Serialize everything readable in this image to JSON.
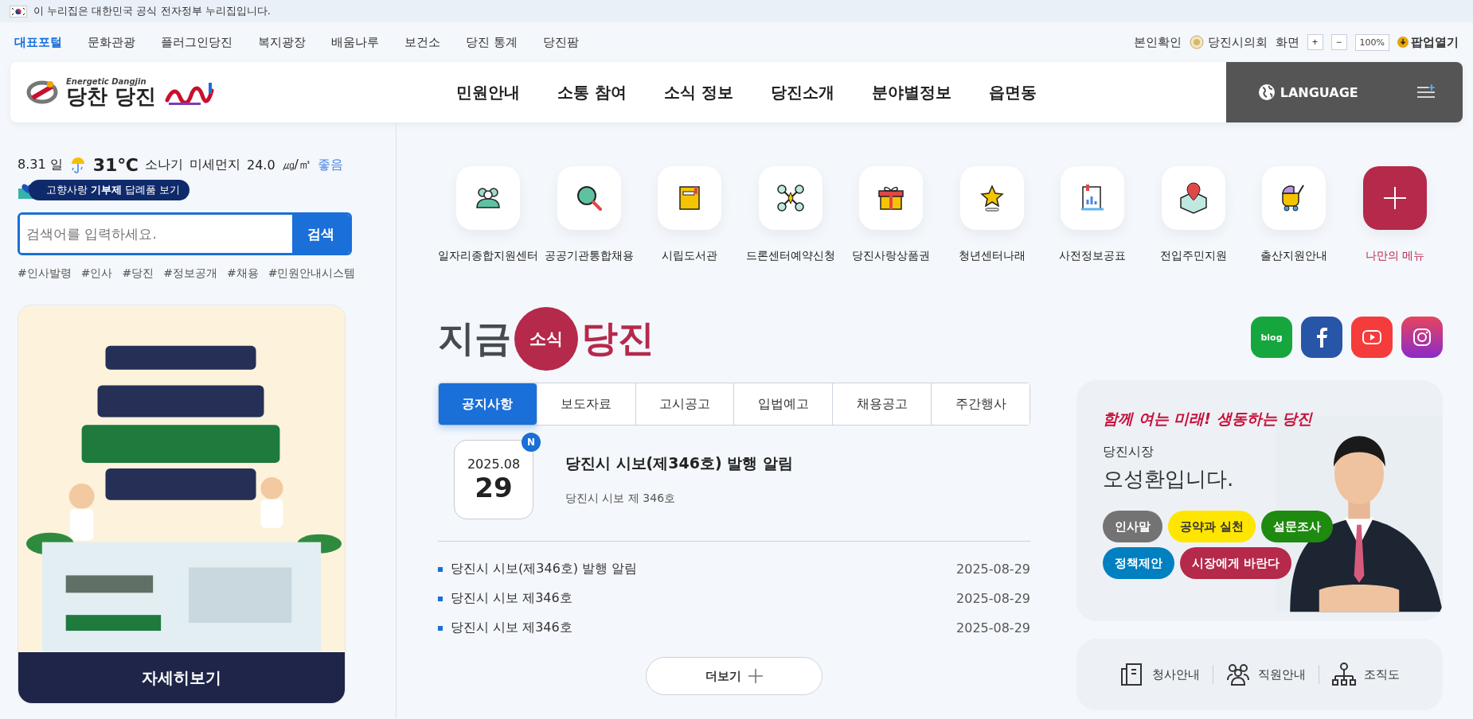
{
  "gov_banner": {
    "text": "이 누리집은 대한민국 공식 전자정부 누리집입니다."
  },
  "utility_nav": {
    "links": [
      {
        "label": "대표포털",
        "selected": true
      },
      {
        "label": "문화관광",
        "selected": false
      },
      {
        "label": "플러그인당진",
        "selected": false
      },
      {
        "label": "복지광장",
        "selected": false
      },
      {
        "label": "배움나루",
        "selected": false
      },
      {
        "label": "보건소",
        "selected": false
      },
      {
        "label": "당진 통계",
        "selected": false
      },
      {
        "label": "당진팜",
        "selected": false
      }
    ],
    "identity": "본인확인",
    "council": "당진시의회",
    "zoom": {
      "label": "화면",
      "plus": "+",
      "minus": "−",
      "value": "100%"
    },
    "popup": "팝업열기"
  },
  "header": {
    "logo": {
      "tagline": "Energetic Dangjin",
      "name": "당찬 당진"
    },
    "menu": [
      "민원안내",
      "소통 참여",
      "소식 정보",
      "당진소개",
      "분야별정보",
      "읍면동"
    ],
    "language": "LANGUAGE"
  },
  "weather": {
    "date": "8.31 일",
    "temperature": "31℃",
    "condition": "소나기",
    "dust_label": "미세먼지",
    "dust_value": "24.0",
    "dust_unit": "㎍/㎥",
    "dust_grade": "좋음"
  },
  "donation_badge": "고향사랑 **기부제** 답례품 보기",
  "search": {
    "placeholder": "검색어를 입력하세요.",
    "button": "검색"
  },
  "tags": [
    "#인사발령",
    "#인사",
    "#당진",
    "#정보공개",
    "#채용",
    "#민원안내시스템"
  ],
  "banner": {
    "kind": "picture",
    "button": "자세히보기"
  },
  "quick_menu": [
    {
      "label": "일자리종합지원센터",
      "kind": "link"
    },
    {
      "label": "공공기관통합채용",
      "kind": "link"
    },
    {
      "label": "시립도서관",
      "kind": "link"
    },
    {
      "label": "드론센터예약신청",
      "kind": "link"
    },
    {
      "label": "당진사랑상품권",
      "kind": "link"
    },
    {
      "label": "청년센터나래",
      "kind": "link"
    },
    {
      "label": "사전정보공표",
      "kind": "link"
    },
    {
      "label": "전입주민지원",
      "kind": "link"
    },
    {
      "label": "출산지원안내",
      "kind": "link"
    },
    {
      "label": "나만의 메뉴",
      "kind": "add"
    }
  ],
  "news": {
    "heading": {
      "before": "지금",
      "circle": "소식",
      "after": "당진"
    },
    "tabs": [
      {
        "label": "공지사항",
        "selected": true
      },
      {
        "label": "보도자료",
        "selected": false
      },
      {
        "label": "고시공고",
        "selected": false
      },
      {
        "label": "입법예고",
        "selected": false
      },
      {
        "label": "채용공고",
        "selected": false
      },
      {
        "label": "주간행사",
        "selected": false
      }
    ],
    "featured": {
      "month": "2025.08",
      "day": "29",
      "badge": "N",
      "title": "당진시 시보(제346호) 발행 알림",
      "summary": "당진시 시보 제 346호"
    },
    "items": [
      {
        "title": "당진시 시보(제346호) 발행 알림",
        "date": "2025-08-29"
      },
      {
        "title": "당진시 시보 제346호",
        "date": "2025-08-29"
      },
      {
        "title": "당진시 시보 제346호",
        "date": "2025-08-29"
      }
    ],
    "more": "더보기"
  },
  "social": [
    {
      "kind": "blog",
      "label": "blog"
    },
    {
      "kind": "facebook"
    },
    {
      "kind": "youtube"
    },
    {
      "kind": "instagram"
    }
  ],
  "mayor": {
    "slogan": "함께 여는 미래! 생동하는 당진",
    "role": "당진시장",
    "name": "오성환입니다.",
    "buttons": [
      {
        "label": "인사말",
        "color": "#737373"
      },
      {
        "label": "공약과 실천",
        "color": "#ffe600"
      },
      {
        "label": "설문조사",
        "color": "#1e8a10"
      },
      {
        "label": "정책제안",
        "color": "#0080c0"
      },
      {
        "label": "시장에게 바란다",
        "color": "#b5294a"
      }
    ]
  },
  "info_links": [
    {
      "label": "청사안내"
    },
    {
      "label": "직원안내"
    },
    {
      "label": "조직도"
    }
  ]
}
